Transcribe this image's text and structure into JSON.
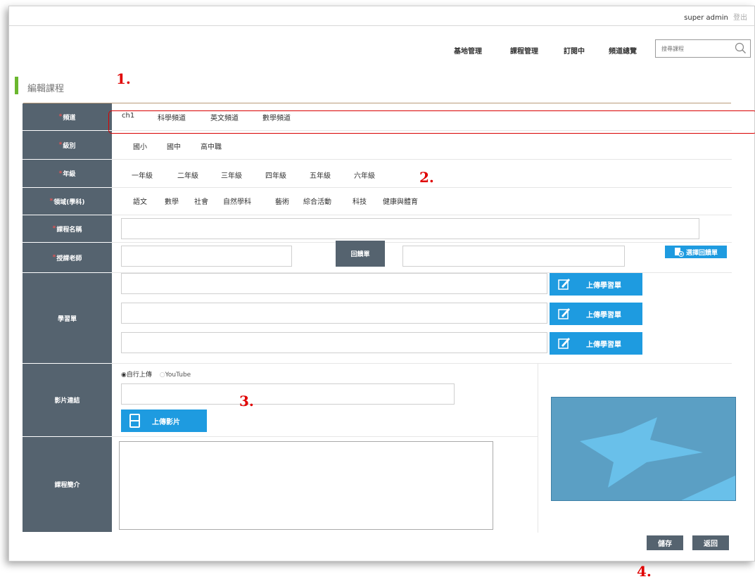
{
  "topbar": {
    "user": "super admin",
    "logout": "登出"
  },
  "nav": {
    "items": [
      "基地管理",
      "課程管理",
      "訂閱中",
      "頻道總覽"
    ],
    "search_placeholder": "搜尋課程"
  },
  "page_title": "編輯課程",
  "form": {
    "channel": {
      "label": "頻道",
      "options": [
        "ch1",
        "科學頻道",
        "英文頻道",
        "數學頻道"
      ]
    },
    "level": {
      "label": "級別",
      "options": [
        "國小",
        "國中",
        "高中職"
      ]
    },
    "grade": {
      "label": "年級",
      "options": [
        "一年級",
        "二年級",
        "三年級",
        "四年級",
        "五年級",
        "六年級"
      ]
    },
    "field": {
      "label": "領域(學科)",
      "options": [
        "語文",
        "數學",
        "社會",
        "自然學科",
        "藝術",
        "綜合活動",
        "科技",
        "健康與體育"
      ]
    },
    "course_name": {
      "label": "課程名稱",
      "value": ""
    },
    "teacher": {
      "label": "授課老師",
      "value": "",
      "button": "回饋單",
      "feedback_value": "",
      "select_button": "選擇回饋單"
    },
    "worksheet": {
      "label": "學習單",
      "upload_label": "上傳學習單"
    },
    "video": {
      "label": "影片連結",
      "radio_options": [
        "自行上傳",
        "YouTube"
      ],
      "selected": "自行上傳",
      "value": "",
      "upload_label": "上傳影片"
    },
    "intro": {
      "label": "課程簡介",
      "value": ""
    }
  },
  "actions": {
    "save": "儲存",
    "back": "返回"
  },
  "annotations": [
    "1.",
    "2.",
    "3.",
    "4."
  ],
  "colors": {
    "label_bg": "#55636f",
    "accent": "#1e9be0",
    "title_bar": "#6bb72e",
    "annotation": "#e00000"
  }
}
